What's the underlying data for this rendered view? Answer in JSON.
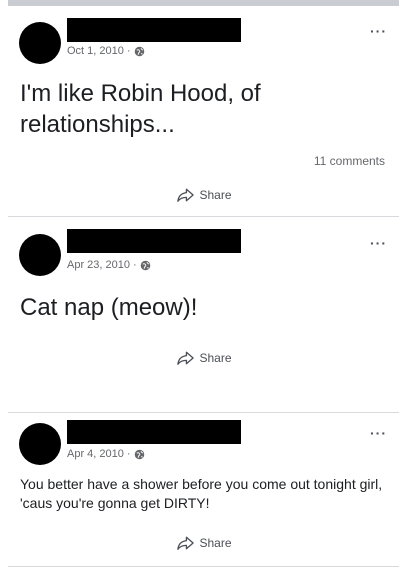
{
  "posts": [
    {
      "date": "Oct 1, 2010",
      "separator": "·",
      "more_label": "···",
      "text": "I'm like Robin Hood, of relationships...",
      "comments": "11 comments",
      "share_label": "Share"
    },
    {
      "date": "Apr 23, 2010",
      "separator": "·",
      "more_label": "···",
      "text": "Cat nap (meow)!",
      "share_label": "Share"
    },
    {
      "date": "Apr 4, 2010",
      "separator": "·",
      "more_label": "···",
      "text": "You better have a shower before you come out tonight girl, 'caus you're gonna get DIRTY!",
      "share_label": "Share"
    }
  ],
  "icons": {
    "audience": "globe-icon",
    "share": "share-icon",
    "more": "more-icon"
  }
}
